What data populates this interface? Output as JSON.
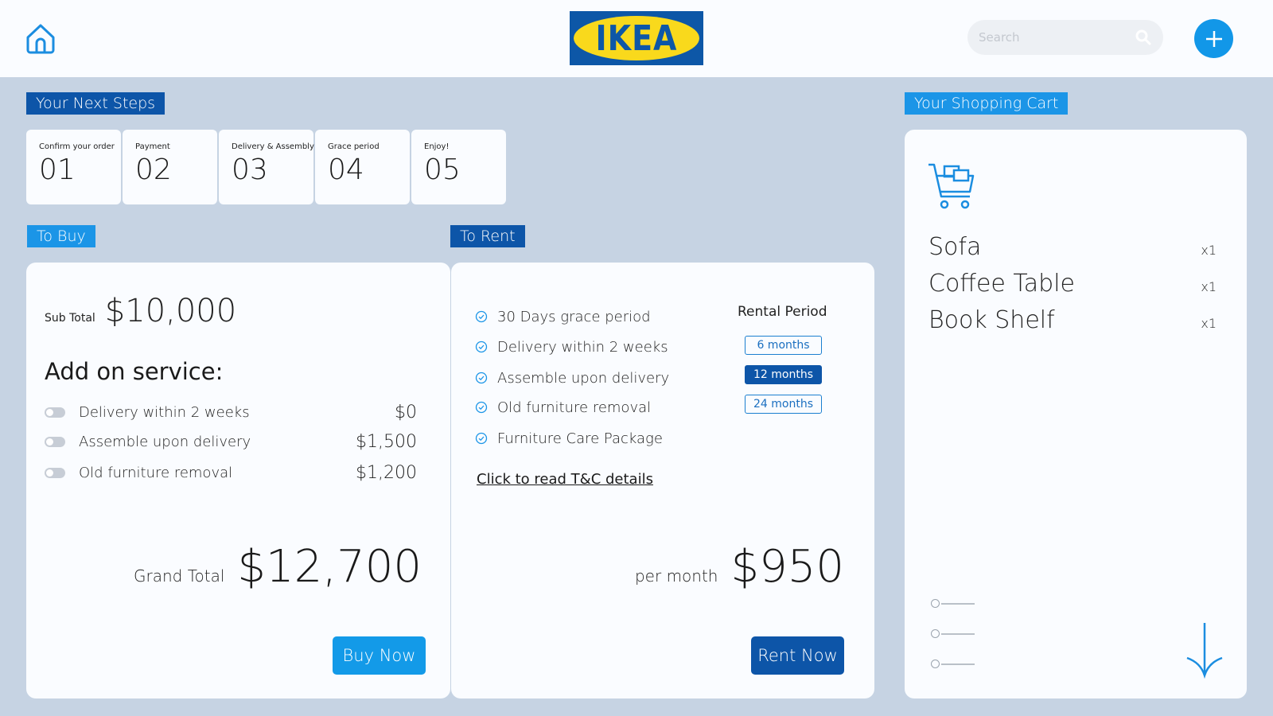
{
  "header": {
    "logo": "IKEA",
    "search_placeholder": "Search",
    "icons": [
      "home-icon",
      "search-icon",
      "plus-icon"
    ],
    "colors": {
      "accent": "#1297e8",
      "brand_blue": "#0d57a7",
      "brand_yellow": "#f9d91c"
    }
  },
  "next_steps": {
    "title": "Your Next Steps",
    "steps": [
      {
        "label": "Confirm your order",
        "num": "01"
      },
      {
        "label": "Payment",
        "num": "02"
      },
      {
        "label": "Delivery & Assembly",
        "num": "03"
      },
      {
        "label": "Grace period",
        "num": "04"
      },
      {
        "label": "Enjoy!",
        "num": "05"
      }
    ]
  },
  "buy": {
    "tag": "To Buy",
    "subtotal_label": "Sub Total",
    "subtotal_value": "$10,000",
    "addon_title": "Add on service:",
    "addons": [
      {
        "label": "Delivery within 2 weeks",
        "price": "$0"
      },
      {
        "label": "Assemble upon delivery",
        "price": "$1,500"
      },
      {
        "label": "Old furniture removal",
        "price": "$1,200"
      }
    ],
    "grand_total_label": "Grand Total",
    "grand_total_value": "$12,700",
    "cta": "Buy Now"
  },
  "rent": {
    "tag": "To Rent",
    "features": [
      "30 Days grace period",
      "Delivery within 2 weeks",
      "Assemble upon delivery",
      "Old furniture removal",
      "Furniture Care Package"
    ],
    "period_title": "Rental Period",
    "periods": [
      "6 months",
      "12 months",
      "24 months"
    ],
    "selected_period": "12 months",
    "tc_link": "Click to read T&C details",
    "per_month_label": "per month",
    "per_month_value": "$950",
    "cta": "Rent Now"
  },
  "cart": {
    "title": "Your Shopping Cart",
    "items": [
      {
        "name": "Sofa",
        "qty": "x1"
      },
      {
        "name": "Coffee Table",
        "qty": "x1"
      },
      {
        "name": "Book Shelf",
        "qty": "x1"
      }
    ]
  }
}
